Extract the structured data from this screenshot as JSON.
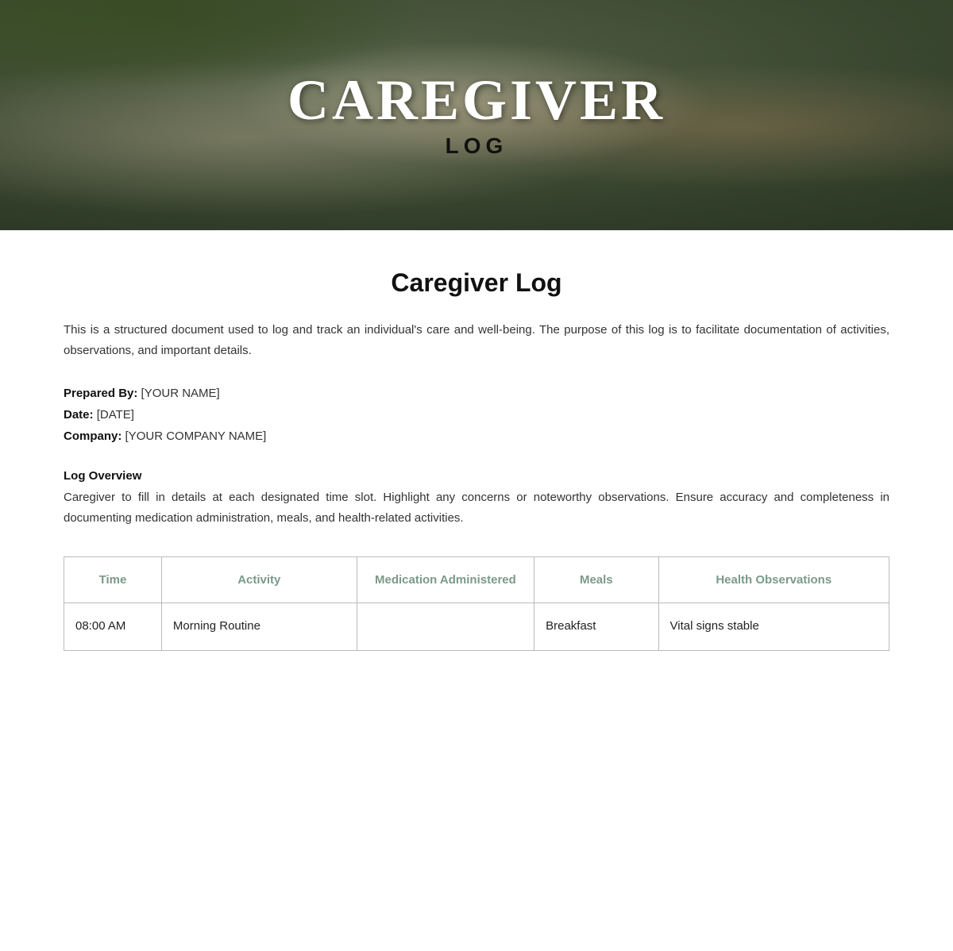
{
  "hero": {
    "title": "CAREGIVER",
    "subtitle": "LOG"
  },
  "document": {
    "title": "Caregiver Log",
    "intro": "This is a structured document used to log and track an individual's care and well-being. The purpose of this log is to facilitate documentation of activities, observations, and important details.",
    "prepared_by_label": "Prepared By:",
    "prepared_by_value": "[YOUR NAME]",
    "date_label": "Date:",
    "date_value": "[DATE]",
    "company_label": "Company:",
    "company_value": "[YOUR COMPANY NAME]",
    "overview_title": "Log Overview",
    "overview_text": "Caregiver to fill in details at each designated time slot. Highlight any concerns or noteworthy observations. Ensure accuracy and completeness in documenting medication administration, meals, and health-related activities."
  },
  "table": {
    "headers": {
      "time": "Time",
      "activity": "Activity",
      "medication": "Medication Administered",
      "meals": "Meals",
      "health": "Health Observations"
    },
    "rows": [
      {
        "time": "08:00 AM",
        "activity": "Morning Routine",
        "medication": "",
        "meals": "Breakfast",
        "health": "Vital signs stable"
      }
    ]
  }
}
